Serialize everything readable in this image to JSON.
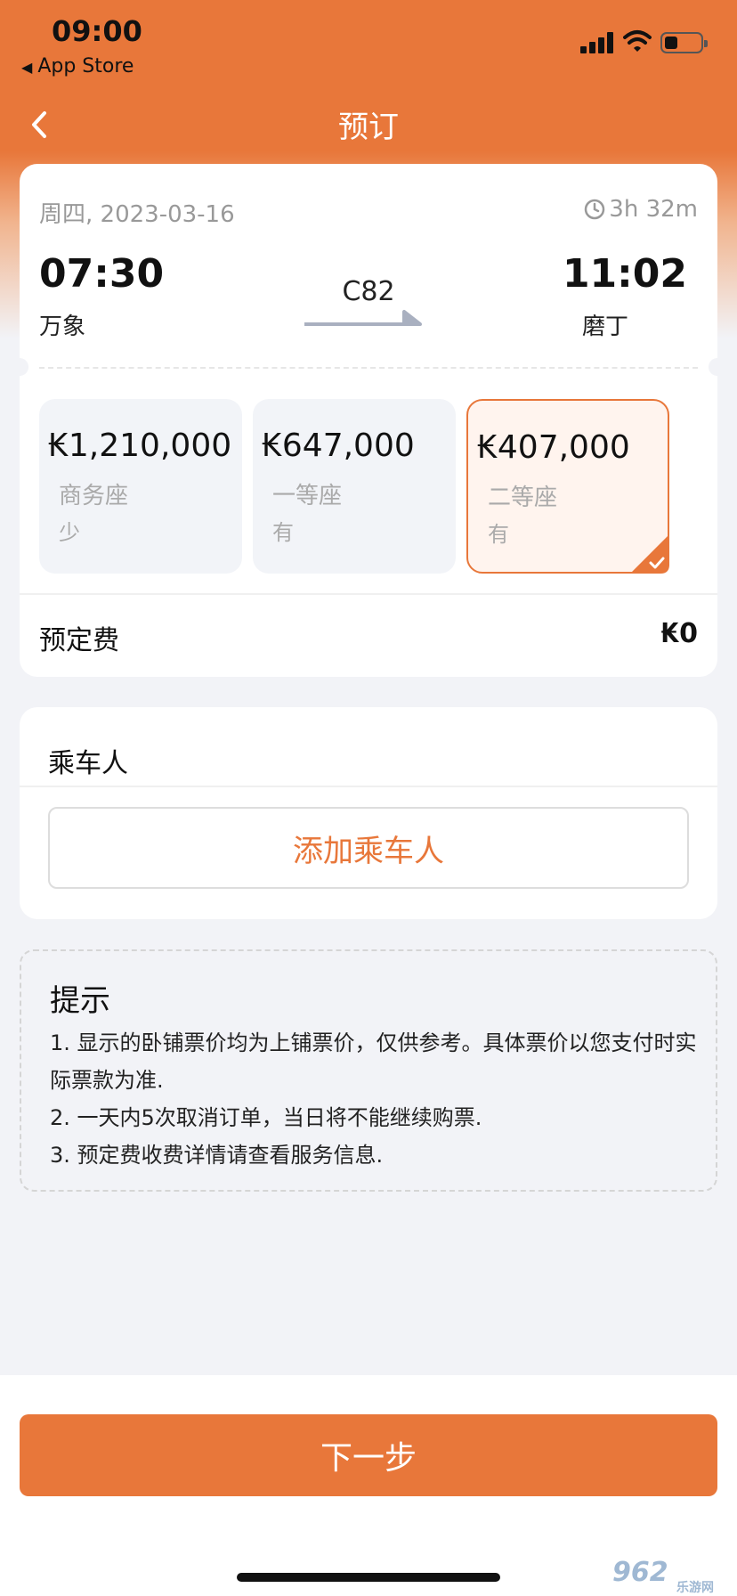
{
  "status_bar": {
    "time": "09:00",
    "back_app": "App Store",
    "icons": [
      "signal-icon",
      "wifi-icon",
      "battery-icon"
    ]
  },
  "nav": {
    "title": "预订",
    "back_icon": "chevron-left-icon"
  },
  "trip": {
    "date": "周四, 2023-03-16",
    "duration": "3h 32m",
    "departure_time": "07:30",
    "departure_station": "万象",
    "arrival_time": "11:02",
    "arrival_station": "磨丁",
    "train_number": "C82"
  },
  "seats": [
    {
      "price": "₭1,210,000",
      "class": "商务座",
      "availability": "少",
      "selected": false
    },
    {
      "price": "₭647,000",
      "class": "一等座",
      "availability": "有",
      "selected": false
    },
    {
      "price": "₭407,000",
      "class": "二等座",
      "availability": "有",
      "selected": true
    }
  ],
  "fee": {
    "label": "预定费",
    "value": "₭0"
  },
  "passengers": {
    "title": "乘车人",
    "add_label": "添加乘车人"
  },
  "tips": {
    "title": "提示",
    "items": [
      "1. 显示的卧铺票价均为上铺票价，仅供参考。具体票价以您支付时实际票款为准.",
      "2. 一天内5次取消订单，当日将不能继续购票.",
      "3. 预定费收费详情请查看服务信息."
    ]
  },
  "next_button": "下一步",
  "watermark": {
    "main": "962",
    "sub": "乐游网"
  },
  "colors": {
    "accent": "#e8773a",
    "background": "#f2f3f7",
    "muted_text": "#999999"
  }
}
